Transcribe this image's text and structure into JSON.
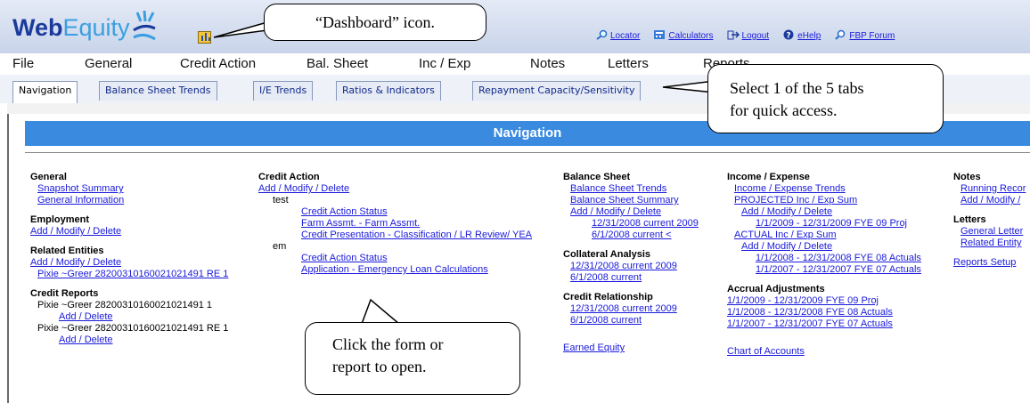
{
  "brand": {
    "logo_part1": "Web",
    "logo_part2": "Equity"
  },
  "toplinks": [
    {
      "label": "Locator",
      "icon": "magnifier-icon"
    },
    {
      "label": "Calculators",
      "icon": "calculator-icon"
    },
    {
      "label": "Logout",
      "icon": "logout-icon"
    },
    {
      "label": "eHelp",
      "icon": "help-icon"
    },
    {
      "label": "FBP Forum",
      "icon": "forum-icon"
    }
  ],
  "menu": [
    "File",
    "General",
    "Credit Action",
    "Bal. Sheet",
    "Inc / Exp",
    "Notes",
    "Letters",
    "Reports"
  ],
  "tabs": [
    "Navigation",
    "Balance Sheet Trends",
    "I/E Trends",
    "Ratios & Indicators",
    "Repayment Capacity/Sensitivity"
  ],
  "nav": {
    "title": "Navigation",
    "general": {
      "heading": "General",
      "links": [
        "Snapshot Summary",
        "General Information"
      ],
      "employment_heading": "Employment",
      "employment_link": "Add / Modify / Delete",
      "related_heading": "Related Entities",
      "related_link": "Add / Modify / Delete",
      "related_item": "Pixie ~Greer 28200310160021021491 RE 1",
      "credit_reports_heading": "Credit Reports",
      "credit_report_1": "Pixie ~Greer 28200310160021021491 1",
      "credit_report_1_link": "Add / Delete",
      "credit_report_2": "Pixie ~Greer 28200310160021021491 RE 1",
      "credit_report_2_link": "Add / Delete"
    },
    "credit_action": {
      "heading": "Credit Action",
      "add_link": "Add / Modify / Delete",
      "group1": "test",
      "group1_links": [
        "Credit Action Status",
        "Farm Assmt. - Farm Assmt.",
        "Credit Presentation - Classification / LR Review/ YEA"
      ],
      "group2": "em",
      "group2_links": [
        "Credit Action Status",
        "Application - Emergency Loan Calculations"
      ]
    },
    "balance_sheet": {
      "heading": "Balance Sheet",
      "links": [
        "Balance Sheet Trends",
        "Balance Sheet Summary",
        "Add / Modify / Delete"
      ],
      "dates": [
        "12/31/2008 current 2009",
        "6/1/2008 current <"
      ],
      "collateral_heading": "Collateral Analysis",
      "collateral_links": [
        "12/31/2008 current 2009",
        "6/1/2008 current"
      ],
      "credit_rel_heading": "Credit Relationship",
      "credit_rel_links": [
        "12/31/2008 current 2009",
        "6/1/2008 current"
      ],
      "earned_equity": "Earned Equity"
    },
    "income_expense": {
      "heading": "Income / Expense",
      "trends": "Income / Expense Trends",
      "projected": "PROJECTED Inc / Exp Sum",
      "projected_add": "Add / Modify / Delete",
      "projected_item": "1/1/2009 - 12/31/2009 FYE 09 Proj",
      "actual": "ACTUAL Inc / Exp Sum",
      "actual_add": "Add / Modify / Delete",
      "actual_items": [
        "1/1/2008 - 12/31/2008 FYE 08 Actuals",
        "1/1/2007 - 12/31/2007 FYE 07 Actuals"
      ],
      "accrual_heading": "Accrual Adjustments",
      "accrual_links": [
        "1/1/2009 - 12/31/2009 FYE 09 Proj",
        "1/1/2008 - 12/31/2008 FYE 08 Actuals",
        "1/1/2007 - 12/31/2007 FYE 07 Actuals"
      ],
      "chart_of_accounts": "Chart of Accounts"
    },
    "notes": {
      "heading": "Notes",
      "links": [
        "Running Recor",
        "Add / Modify /"
      ],
      "letters_heading": "Letters",
      "letters_links": [
        "General Letter",
        "Related Entity"
      ],
      "reports_setup": "Reports Setup"
    }
  },
  "callouts": {
    "dashboard": "“Dashboard” icon.",
    "tabs_line1": "Select 1 of the 5 tabs",
    "tabs_line2": "for quick access.",
    "form_line1": "Click the form or",
    "form_line2": "report to open."
  }
}
